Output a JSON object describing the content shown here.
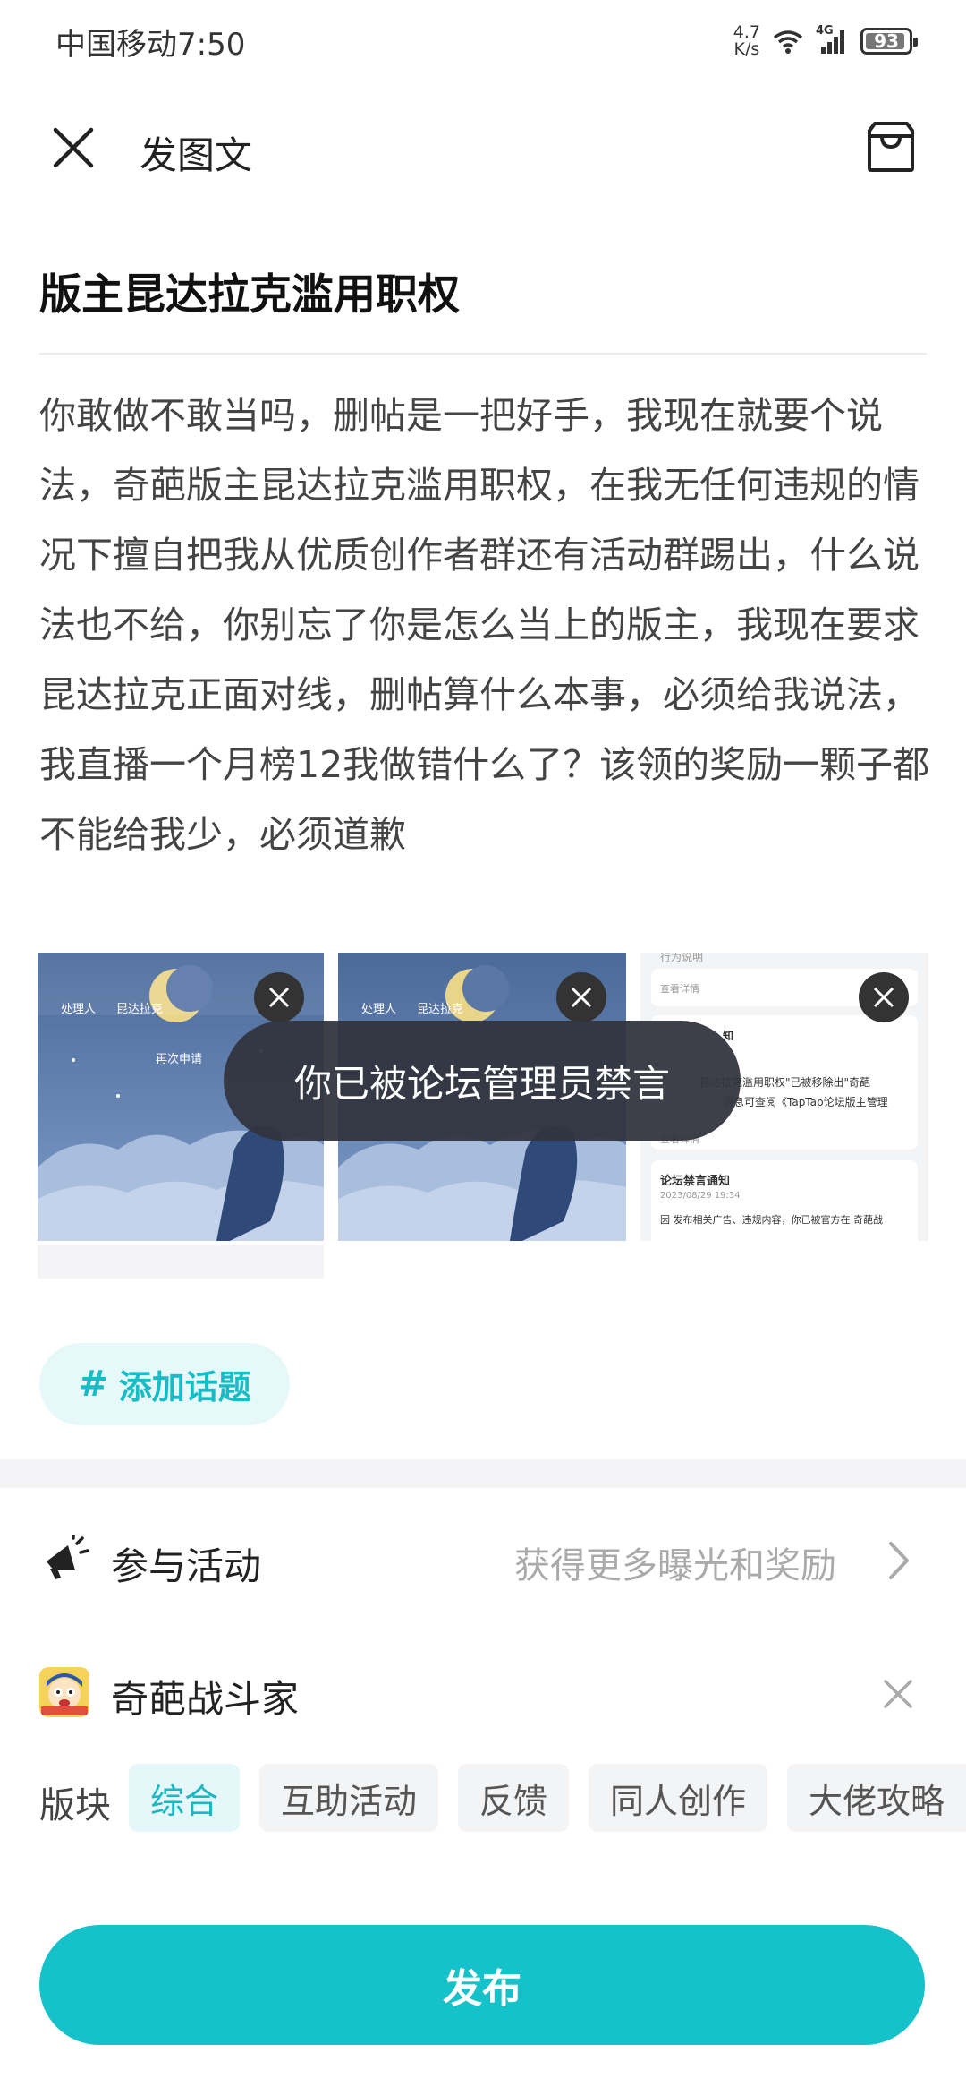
{
  "status_bar": {
    "carrier_time": "中国移动7:50",
    "net_speed_value": "4.7",
    "net_speed_unit": "K/s",
    "network_type": "4G",
    "battery": "93",
    "battery_level": 0.93
  },
  "header": {
    "title": "发图文"
  },
  "post": {
    "title": "版主昆达拉克滥用职权",
    "body": "你敢做不敢当吗，删帖是一把好手，我现在就要个说法，奇葩版主昆达拉克滥用职权，在我无任何违规的情况下擅自把我从优质创作者群还有活动群踢出，什么说法也不给，你别忘了你是怎么当上的版主，我现在要求昆达拉克正面对线，删帖算什么本事，必须给我说法，我直播一个月榜12我做错什么了？该领的奖励一颗子都不能给我少，必须道歉"
  },
  "images": {
    "thumb1": {
      "handler_label": "处理人",
      "handler_name": "昆达拉克",
      "reapply": "再次申请"
    },
    "thumb2": {
      "handler_label": "处理人",
      "handler_name": "昆达拉克"
    },
    "thumb3": {
      "top_text": "行为说明",
      "view_details_1": "查看详情",
      "notice_title_partial": "知",
      "notice_line_1": "昆达拉克滥用职权\"已被移除出\"奇葩",
      "notice_line_2": "消息可查阅《TapTap论坛版主管理",
      "view_details_2": "查看详情",
      "ban_title": "论坛禁言通知",
      "ban_date": "2023/08/29 19:34",
      "ban_text": "因 发布相关广告、违规内容，你已被官方在 奇葩战"
    }
  },
  "toast": {
    "message": "你已被论坛管理员禁言"
  },
  "topic": {
    "hash": "#",
    "label": "添加话题"
  },
  "activity": {
    "label": "参与活动",
    "hint": "获得更多曝光和奖励"
  },
  "game": {
    "name": "奇葩战斗家"
  },
  "sections": {
    "label": "版块",
    "tags": [
      "综合",
      "互助活动",
      "反馈",
      "同人创作",
      "大佬攻略"
    ],
    "selected": "综合"
  },
  "publish": {
    "label": "发布"
  },
  "colors": {
    "accent": "#16c2ca",
    "toast_bg": "#32343e",
    "tag_active_bg": "#e5f7f8"
  }
}
